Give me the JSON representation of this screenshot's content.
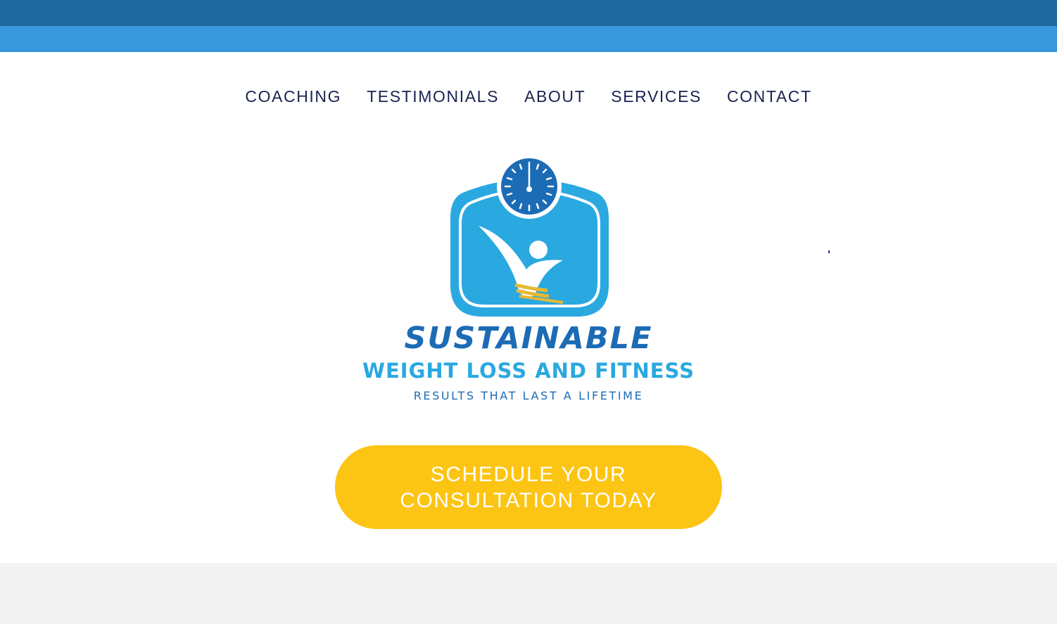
{
  "colors": {
    "top_bar_dark": "#1e6a9e",
    "top_bar_light": "#3798db",
    "nav_text": "#1a2350",
    "cta_background": "#fcc413",
    "cta_text": "#ffffff",
    "logo_primary": "#1c6bb5",
    "logo_secondary": "#2aa8e0",
    "footer_background": "#f3f3f3"
  },
  "nav": {
    "items": [
      {
        "label": "COACHING"
      },
      {
        "label": "TESTIMONIALS"
      },
      {
        "label": "ABOUT"
      },
      {
        "label": "SERVICES"
      },
      {
        "label": "CONTACT"
      }
    ]
  },
  "logo": {
    "icon": "scale-with-figure-icon",
    "line1": "SUSTAINABLE",
    "line2": "WEIGHT LOSS AND FITNESS",
    "line3": "RESULTS THAT LAST A LIFETIME"
  },
  "cta": {
    "line1": "SCHEDULE YOUR",
    "line2": "CONSULTATION TODAY"
  }
}
